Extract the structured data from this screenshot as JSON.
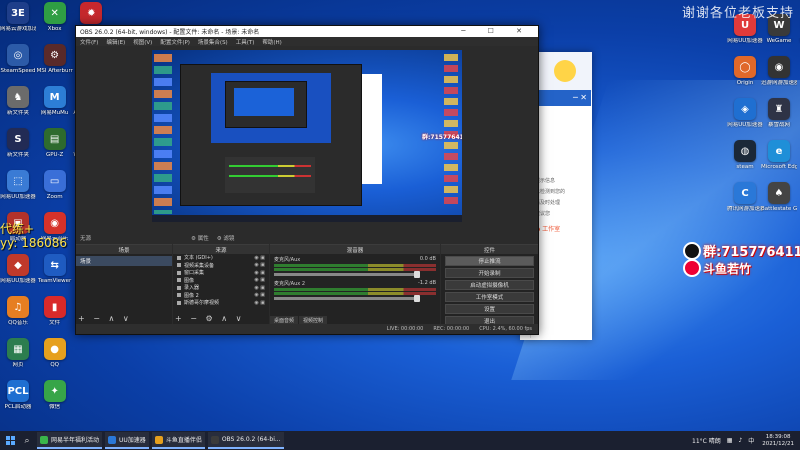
{
  "watermark": "谢谢各位老板支持",
  "overlay": {
    "qq": "群:715776411",
    "douyu": "斗鱼若竹",
    "left_text_1": "代练+",
    "left_text_2": "yy: 186086"
  },
  "desktop_icons_left": [
    {
      "label": "网易云游戏加速器",
      "glyph": "3E",
      "color": "#1e3e8a"
    },
    {
      "label": "SteamSpeed",
      "glyph": "◎",
      "color": "#2c5ba8"
    },
    {
      "label": "新文件夹",
      "glyph": "♞",
      "color": "#6b6b6b"
    },
    {
      "label": "新文件夹",
      "glyph": "S",
      "color": "#222b55"
    },
    {
      "label": "网易UU加速器",
      "glyph": "⬚",
      "color": "#3a7bd5"
    },
    {
      "label": "启动器",
      "glyph": "▣",
      "color": "#b3322a"
    },
    {
      "label": "网易UU加速器",
      "glyph": "◆",
      "color": "#c0392b"
    },
    {
      "label": "QQ音乐",
      "glyph": "♫",
      "color": "#e67e22"
    },
    {
      "label": "网页",
      "glyph": "▦",
      "color": "#2c7d4f"
    },
    {
      "label": "PCL启动器",
      "glyph": "PCL",
      "color": "#1f6fd1"
    },
    {
      "label": "Xbox",
      "glyph": "✕",
      "color": "#2f9e44"
    },
    {
      "label": "MSI Afterburner",
      "glyph": "⚙",
      "color": "#5a2a2a"
    },
    {
      "label": "网易MuMu",
      "glyph": "M",
      "color": "#2d7ed6"
    },
    {
      "label": "GPU-Z",
      "glyph": "▤",
      "color": "#2e6b2e"
    },
    {
      "label": "Zoom",
      "glyph": "▭",
      "color": "#3a6fd8"
    },
    {
      "label": "网易云音乐",
      "glyph": "◉",
      "color": "#d6322a"
    },
    {
      "label": "TeamViewer",
      "glyph": "⇆",
      "color": "#1f5cc2"
    },
    {
      "label": "文件",
      "glyph": "▮",
      "color": "#d92a2a"
    },
    {
      "label": "QQ",
      "glyph": "●",
      "color": "#e6a01e"
    },
    {
      "label": "微信",
      "glyph": "✦",
      "color": "#37a548"
    },
    {
      "label": "Battle.net",
      "glyph": "✹",
      "color": "#c6282d"
    },
    {
      "label": "CurseForge",
      "glyph": "⚔",
      "color": "#b0302a"
    },
    {
      "label": "Apex Legends",
      "glyph": "A",
      "color": "#c23020"
    },
    {
      "label": "Windows 更新助手",
      "glyph": "⊞",
      "color": "#3b7fe0"
    },
    {
      "label": "WeGame",
      "glyph": "◐",
      "color": "#3a8ee6"
    },
    {
      "label": "SF启动器",
      "glyph": "SF",
      "color": "#2b2b2b"
    }
  ],
  "desktop_icons_right": [
    {
      "label": "网易UU加速器",
      "glyph": "U",
      "color": "#e03a3a"
    },
    {
      "label": "Origin",
      "glyph": "◯",
      "color": "#e0682a"
    },
    {
      "label": "网易UU加速器",
      "glyph": "◈",
      "color": "#1f6fd1"
    },
    {
      "label": "steam",
      "glyph": "◍",
      "color": "#1b2838"
    },
    {
      "label": "腾讯网游加速器",
      "glyph": "C",
      "color": "#2a78d8"
    },
    {
      "label": "WeGame",
      "glyph": "W",
      "color": "#3a3a3a"
    },
    {
      "label": "迅游网游加速器",
      "glyph": "◉",
      "color": "#333333"
    },
    {
      "label": "暴雪战网",
      "glyph": "♜",
      "color": "#2e3346"
    },
    {
      "label": "Microsoft Edge",
      "glyph": "e",
      "color": "#1f8fd8"
    },
    {
      "label": "Battlestate Games L...",
      "glyph": "♠",
      "color": "#444444"
    },
    {
      "label": "网易BUFF",
      "glyph": "⚙",
      "color": "#555555"
    }
  ],
  "bg_window": {
    "controls": "─ ✕",
    "text_lines": [
      "提示信息",
      "已检测到您的",
      "请及时处理",
      "建议您"
    ],
    "rec_text": "● 工作室"
  },
  "obs": {
    "title": "OBS 26.0.2 (64-bit, windows) - 配置文件: 未命名 - 场景: 未命名",
    "title_controls": "─ ☐ ✕",
    "menu": [
      "文件(F)",
      "编辑(E)",
      "视图(V)",
      "配置文件(P)",
      "场景集合(S)",
      "工具(T)",
      "帮助(H)"
    ],
    "preview_label": "群:715776411",
    "subbar_left": "无源",
    "subbar_props": "⚙ 属性",
    "subbar_filters": "⚙ 滤镜",
    "panels": {
      "scenes": "场景",
      "sources": "来源",
      "mixer": "混音器",
      "controls": "控件"
    },
    "scene_items": [
      "场景"
    ],
    "source_items": [
      "文本 (GDI+)",
      "视频采集设备",
      "窗口采集",
      "图像",
      "录入器",
      "图像 2",
      "斯德哥尔摩视频"
    ],
    "mixer_channels": [
      {
        "name": "麦克风/Aux",
        "db": "0.0 dB"
      },
      {
        "name": "麦克风/Aux 2",
        "db": "-1.2 dB"
      }
    ],
    "mixer_tabs": [
      "桌面音频",
      "视频控制"
    ],
    "control_buttons": [
      "停止推流",
      "开始录制",
      "启动虚拟摄像机",
      "工作室模式",
      "设置",
      "退出"
    ],
    "status": {
      "live": "LIVE: 00:00:00",
      "rec": "REC: 00:00:00",
      "cpu": "CPU: 2.4%, 60.00 fps"
    }
  },
  "taskbar": {
    "search_icon": "⌕",
    "tasks": [
      {
        "label": "网易半年福利活动",
        "color": "#3ab54a"
      },
      {
        "label": "UU加速器",
        "color": "#2a78d8"
      },
      {
        "label": "斗鱼直播伴侣",
        "color": "#e6a01e"
      },
      {
        "label": "OBS 26.0.2 (64-bi...",
        "color": "#3b3b3b"
      }
    ],
    "weather": "11°C 晴朗",
    "ime": "中",
    "time": "18:39:08",
    "date": "2021/12/21"
  }
}
